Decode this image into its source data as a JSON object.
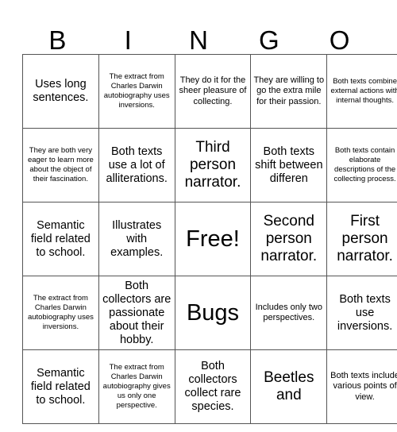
{
  "card": {
    "header_letters": [
      "B",
      "I",
      "N",
      "G",
      "O"
    ],
    "rows": [
      [
        {
          "text": "Uses long sentences.",
          "size": "md"
        },
        {
          "text": "The extract from Charles Darwin autobiography uses inversions.",
          "size": "xs"
        },
        {
          "text": "They do it for the sheer pleasure of collecting.",
          "size": "sm"
        },
        {
          "text": "They are willing to go the extra mile for their passion.",
          "size": "sm"
        },
        {
          "text": "Both texts combine external actions with internal thoughts.",
          "size": "xs"
        }
      ],
      [
        {
          "text": "They are both very eager to learn more about the object of their fascination.",
          "size": "xs"
        },
        {
          "text": "Both texts use a lot of alliterations.",
          "size": "md"
        },
        {
          "text": "Third person narrator.",
          "size": "lg"
        },
        {
          "text": "Both texts shift between differen",
          "size": "md"
        },
        {
          "text": "Both texts contain elaborate descriptions of the collecting process.",
          "size": "xs"
        }
      ],
      [
        {
          "text": "Semantic field related to school.",
          "size": "md"
        },
        {
          "text": "Illustrates with examples.",
          "size": "md"
        },
        {
          "text": "Free!",
          "size": "xl"
        },
        {
          "text": "Second person narrator.",
          "size": "lg"
        },
        {
          "text": "First person narrator.",
          "size": "lg"
        }
      ],
      [
        {
          "text": "The extract from Charles Darwin autobiography uses inversions.",
          "size": "xs"
        },
        {
          "text": "Both collectors are passionate about their hobby.",
          "size": "md"
        },
        {
          "text": "Bugs",
          "size": "xl"
        },
        {
          "text": "Includes only two perspectives.",
          "size": "sm"
        },
        {
          "text": "Both texts use inversions.",
          "size": "md"
        }
      ],
      [
        {
          "text": "Semantic field related to school.",
          "size": "md"
        },
        {
          "text": "The extract from Charles Darwin autobiography gives us only one perspective.",
          "size": "xs"
        },
        {
          "text": "Both collectors collect rare species.",
          "size": "md"
        },
        {
          "text": "Beetles and",
          "size": "lg"
        },
        {
          "text": "Both texts include various points of view.",
          "size": "sm"
        }
      ]
    ]
  }
}
